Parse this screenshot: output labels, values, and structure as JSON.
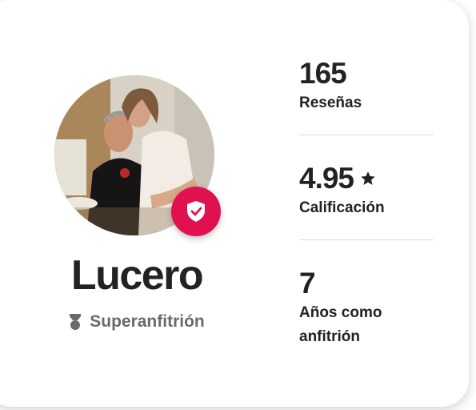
{
  "host": {
    "name": "Lucero",
    "badge_label": "Superanfitrión",
    "avatar_icon": "host-photo",
    "verified_icon": "shield-check-icon",
    "superhost_icon": "superhost-medal-icon"
  },
  "stats": {
    "reviews": {
      "value": "165",
      "label": "Reseñas"
    },
    "rating": {
      "value": "4.95",
      "label": "Calificación",
      "icon": "star-icon"
    },
    "years": {
      "value": "7",
      "label_line1": "Años como",
      "label_line2": "anfitrión"
    }
  },
  "colors": {
    "accent": "#e0114f",
    "text_primary": "#222222",
    "text_secondary": "#6a6a6a",
    "divider": "#dddddd"
  }
}
